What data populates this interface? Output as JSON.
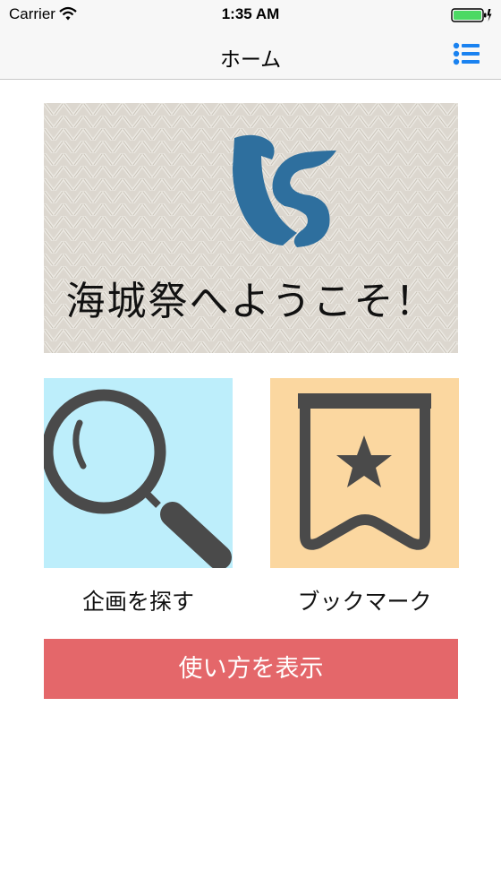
{
  "status_bar": {
    "carrier": "Carrier",
    "time": "1:35 AM",
    "wifi_icon": "wifi-icon",
    "battery_icon": "battery-charging-icon"
  },
  "nav": {
    "title": "ホーム",
    "menu_icon": "list-menu-icon"
  },
  "banner": {
    "logo": "ks-logo",
    "welcome_text": "海城祭へようこそ！"
  },
  "tiles": [
    {
      "label": "企画を探す",
      "icon": "magnifier-icon",
      "color": "#bdeefb"
    },
    {
      "label": "ブックマーク",
      "icon": "bookmark-star-icon",
      "color": "#fbd7a0"
    }
  ],
  "usage_button": {
    "label": "使い方を表示",
    "color": "#e4676a"
  },
  "colors": {
    "accent": "#1a82f0",
    "logo_blue": "#2e6f9e",
    "icon_dark": "#4a4a4a"
  }
}
